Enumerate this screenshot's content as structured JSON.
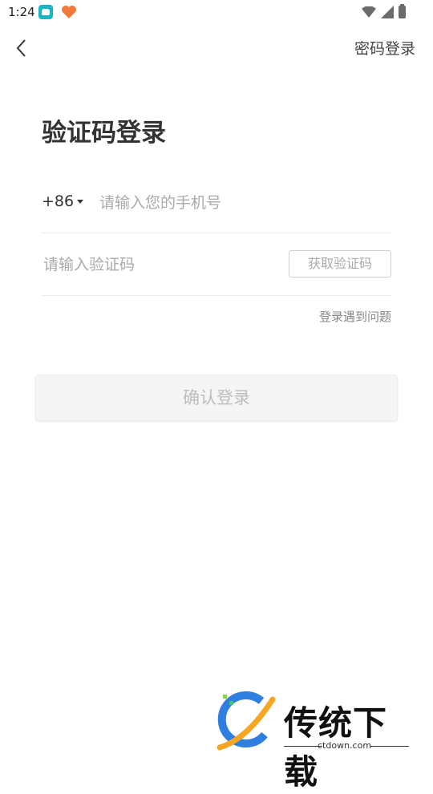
{
  "status_bar": {
    "time": "1:24"
  },
  "header": {
    "back_icon": "chevron-left-icon",
    "right_link": "密码登录"
  },
  "title": "验证码登录",
  "phone": {
    "country_code": "+86",
    "placeholder": "请输入您的手机号",
    "value": ""
  },
  "code": {
    "placeholder": "请输入验证码",
    "value": "",
    "get_code_label": "获取验证码"
  },
  "help_link": "登录遇到问题",
  "confirm_label": "确认登录",
  "watermark": {
    "name": "传统下载",
    "url": "ctdown.com"
  }
}
